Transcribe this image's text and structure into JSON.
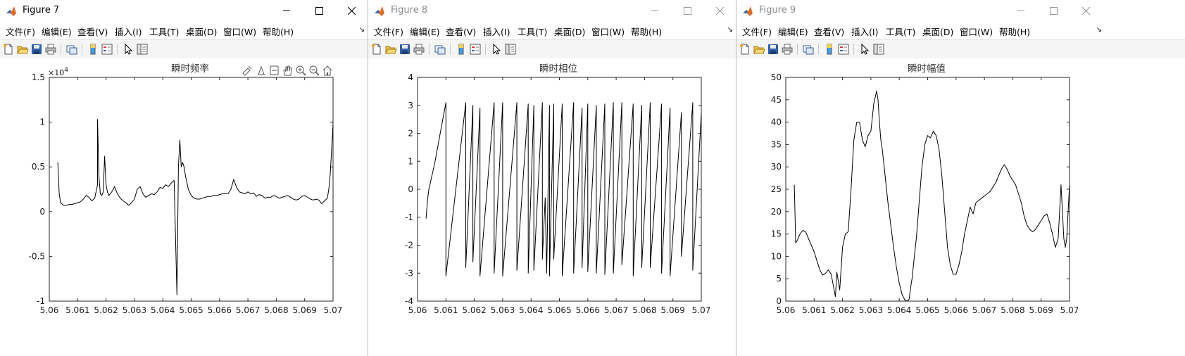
{
  "windows": [
    {
      "title": "Figure 7",
      "active": true,
      "menus": [
        "文件(F)",
        "编辑(E)",
        "查看(V)",
        "插入(I)",
        "工具(T)",
        "桌面(D)",
        "窗口(W)",
        "帮助(H)"
      ],
      "more_glyph": "↘",
      "axes_toolbar": [
        "brush-icon",
        "datatip-icon",
        "rotate-icon",
        "pan-hand-icon",
        "zoom-in-icon",
        "zoom-out-icon",
        "home-icon"
      ]
    },
    {
      "title": "Figure 8",
      "active": false,
      "menus": [
        "文件(F)",
        "编辑(E)",
        "查看(V)",
        "插入(I)",
        "工具(T)",
        "桌面(D)",
        "窗口(W)",
        "帮助(H)"
      ],
      "more_glyph": "↘"
    },
    {
      "title": "Figure 9",
      "active": false,
      "menus": [
        "文件(F)",
        "编辑(E)",
        "查看(V)",
        "插入(I)",
        "工具(T)",
        "桌面(D)",
        "窗口(W)",
        "帮助(H)"
      ],
      "more_glyph": "↘"
    }
  ],
  "toolbar_icons": [
    "new-figure-icon",
    "open-file-icon",
    "save-icon",
    "print-icon",
    "link-plot-icon",
    "insert-colorbar-icon",
    "insert-legend-icon",
    "edit-plot-icon",
    "property-inspector-icon"
  ],
  "colors": {
    "line": "#000000",
    "axis": "#262626",
    "tick_label": "#1a1a1a",
    "window_bg": "#ffffff",
    "toolbar_bg": "#f5f5f5"
  },
  "chart_data": [
    {
      "type": "line",
      "title": "瞬时频率",
      "exponent_label": "×10",
      "exponent_power": "4",
      "xlim": [
        5.06,
        5.07
      ],
      "ylim": [
        -1,
        1.5
      ],
      "xticks": [
        "5.06",
        "5.061",
        "5.062",
        "5.063",
        "5.064",
        "5.065",
        "5.066",
        "5.067",
        "5.068",
        "5.069",
        "5.07"
      ],
      "yticks": [
        "1.5",
        "1",
        "0.5",
        "0",
        "-0.5",
        "-1"
      ],
      "ytick_values": [
        1.5,
        1,
        0.5,
        0,
        -0.5,
        -1
      ],
      "x": [
        5.0603,
        5.06035,
        5.0604,
        5.0605,
        5.0606,
        5.0607,
        5.0608,
        5.0609,
        5.061,
        5.0611,
        5.0612,
        5.0613,
        5.0614,
        5.0615,
        5.0616,
        5.0617,
        5.0617,
        5.06175,
        5.0618,
        5.06185,
        5.0619,
        5.06195,
        5.062,
        5.06205,
        5.0621,
        5.06215,
        5.0622,
        5.0623,
        5.0624,
        5.0625,
        5.0626,
        5.0627,
        5.0628,
        5.0629,
        5.063,
        5.0631,
        5.0632,
        5.0633,
        5.0634,
        5.0635,
        5.0636,
        5.0637,
        5.0638,
        5.0639,
        5.064,
        5.0641,
        5.0642,
        5.0643,
        5.0644,
        5.0645,
        5.06455,
        5.0646,
        5.06465,
        5.0647,
        5.06475,
        5.0648,
        5.0649,
        5.065,
        5.0651,
        5.0652,
        5.0653,
        5.0654,
        5.0655,
        5.0656,
        5.0657,
        5.0658,
        5.0659,
        5.066,
        5.0661,
        5.0662,
        5.0663,
        5.0664,
        5.0665,
        5.0666,
        5.0667,
        5.0668,
        5.0669,
        5.067,
        5.0671,
        5.0672,
        5.0673,
        5.0674,
        5.0675,
        5.0676,
        5.0677,
        5.0678,
        5.0679,
        5.068,
        5.0681,
        5.0682,
        5.0683,
        5.0684,
        5.0685,
        5.0686,
        5.0687,
        5.0688,
        5.0689,
        5.069,
        5.0691,
        5.0692,
        5.0693,
        5.0694,
        5.0695,
        5.0696,
        5.0697,
        5.0698,
        5.06985,
        5.0699,
        5.07
      ],
      "y": [
        0.55,
        0.2,
        0.1,
        0.07,
        0.07,
        0.08,
        0.08,
        0.09,
        0.1,
        0.11,
        0.14,
        0.18,
        0.16,
        0.12,
        0.15,
        0.3,
        1.03,
        0.4,
        0.2,
        0.18,
        0.22,
        0.62,
        0.3,
        0.22,
        0.18,
        0.2,
        0.22,
        0.28,
        0.2,
        0.15,
        0.12,
        0.1,
        0.07,
        0.1,
        0.14,
        0.25,
        0.28,
        0.2,
        0.16,
        0.18,
        0.2,
        0.19,
        0.22,
        0.27,
        0.26,
        0.3,
        0.28,
        0.32,
        0.35,
        -0.93,
        0.5,
        0.8,
        0.5,
        0.55,
        0.5,
        0.4,
        0.25,
        0.18,
        0.15,
        0.14,
        0.14,
        0.15,
        0.16,
        0.17,
        0.17,
        0.18,
        0.18,
        0.19,
        0.2,
        0.2,
        0.2,
        0.25,
        0.36,
        0.27,
        0.22,
        0.21,
        0.2,
        0.22,
        0.2,
        0.21,
        0.17,
        0.19,
        0.18,
        0.15,
        0.16,
        0.16,
        0.18,
        0.17,
        0.15,
        0.16,
        0.17,
        0.18,
        0.16,
        0.14,
        0.13,
        0.14,
        0.17,
        0.18,
        0.16,
        0.14,
        0.13,
        0.14,
        0.13,
        0.09,
        0.12,
        0.15,
        0.25,
        0.42,
        0.97
      ],
      "grid": false
    },
    {
      "type": "line",
      "title": "瞬时相位",
      "xlim": [
        5.06,
        5.07
      ],
      "ylim": [
        -4,
        4
      ],
      "xticks": [
        "5.06",
        "5.061",
        "5.062",
        "5.063",
        "5.064",
        "5.065",
        "5.066",
        "5.067",
        "5.068",
        "5.069",
        "5.07"
      ],
      "yticks": [
        "4",
        "3",
        "2",
        "1",
        "0",
        "-1",
        "-2",
        "-3",
        "-4"
      ],
      "ytick_values": [
        4,
        3,
        2,
        1,
        0,
        -1,
        -2,
        -3,
        -4
      ],
      "x": [
        5.0603,
        5.06035,
        5.0604,
        5.0606,
        5.0608,
        5.061,
        5.061,
        5.0617,
        5.0617,
        5.06195,
        5.06195,
        5.0622,
        5.0622,
        5.0627,
        5.0627,
        5.063,
        5.063,
        5.0635,
        5.0635,
        5.0639,
        5.0639,
        5.0641,
        5.0641,
        5.0644,
        5.0644,
        5.0645,
        5.06455,
        5.06465,
        5.06465,
        5.0648,
        5.0648,
        5.0651,
        5.0651,
        5.0655,
        5.0655,
        5.0658,
        5.0658,
        5.066,
        5.066,
        5.0663,
        5.0663,
        5.0666,
        5.0666,
        5.0669,
        5.0669,
        5.0672,
        5.0672,
        5.0676,
        5.0676,
        5.0679,
        5.0679,
        5.0682,
        5.0682,
        5.0686,
        5.0686,
        5.0689,
        5.0689,
        5.0693,
        5.0693,
        5.0697,
        5.0697,
        5.07
      ],
      "y": [
        -1.05,
        -0.4,
        0,
        0.9,
        2.0,
        3.1,
        -3.1,
        3.1,
        -2.8,
        3.0,
        -2.6,
        2.9,
        -3.1,
        3.1,
        -3.0,
        3.1,
        -3.1,
        3.1,
        -2.9,
        3.05,
        -3.0,
        3.0,
        -2.9,
        3.1,
        -2.5,
        -0.3,
        -3.0,
        3.0,
        -3.1,
        3.05,
        -2.5,
        3.05,
        -3.1,
        3.1,
        -3.0,
        2.9,
        -2.8,
        3.05,
        -2.95,
        3.0,
        -3.0,
        3.05,
        -3.05,
        3.1,
        -3.0,
        3.1,
        -2.7,
        3.05,
        -3.1,
        3.0,
        -2.8,
        3.1,
        -2.8,
        3.05,
        -3.0,
        2.9,
        -3.1,
        2.75,
        -2.4,
        3.1,
        -2.9,
        2.7
      ],
      "grid": false
    },
    {
      "type": "line",
      "title": "瞬时幅值",
      "xlim": [
        5.06,
        5.07
      ],
      "ylim": [
        0,
        50
      ],
      "xticks": [
        "5.06",
        "5.061",
        "5.062",
        "5.063",
        "5.064",
        "5.065",
        "5.066",
        "5.067",
        "5.068",
        "5.069",
        "5.07"
      ],
      "yticks": [
        "50",
        "45",
        "40",
        "35",
        "30",
        "25",
        "20",
        "15",
        "10",
        "5",
        "0"
      ],
      "ytick_values": [
        50,
        45,
        40,
        35,
        30,
        25,
        20,
        15,
        10,
        5,
        0
      ],
      "x": [
        5.0603,
        5.06035,
        5.0604,
        5.0605,
        5.0606,
        5.0607,
        5.0608,
        5.0609,
        5.061,
        5.0611,
        5.0612,
        5.0613,
        5.0614,
        5.0615,
        5.0616,
        5.06175,
        5.0618,
        5.0619,
        5.062,
        5.0621,
        5.0622,
        5.0623,
        5.0624,
        5.0625,
        5.0626,
        5.0627,
        5.0628,
        5.0629,
        5.063,
        5.0631,
        5.0632,
        5.06325,
        5.0633,
        5.06335,
        5.0634,
        5.0635,
        5.0636,
        5.0637,
        5.0638,
        5.0639,
        5.064,
        5.0641,
        5.0642,
        5.0643,
        5.06435,
        5.0644,
        5.06445,
        5.0645,
        5.0646,
        5.0647,
        5.0648,
        5.0649,
        5.065,
        5.0651,
        5.0652,
        5.0653,
        5.0654,
        5.0655,
        5.0656,
        5.0657,
        5.0658,
        5.0659,
        5.066,
        5.0661,
        5.0662,
        5.0663,
        5.0664,
        5.0665,
        5.0666,
        5.0667,
        5.0668,
        5.0669,
        5.067,
        5.0671,
        5.0672,
        5.0673,
        5.0674,
        5.0675,
        5.0676,
        5.0677,
        5.0678,
        5.0679,
        5.068,
        5.0681,
        5.0682,
        5.0683,
        5.0684,
        5.0685,
        5.0686,
        5.0687,
        5.0688,
        5.0689,
        5.069,
        5.0691,
        5.0692,
        5.0693,
        5.0694,
        5.0695,
        5.0696,
        5.0697,
        5.0698,
        5.06985,
        5.0699,
        5.06995,
        5.07
      ],
      "y": [
        26,
        13,
        13.5,
        15,
        15.8,
        15.5,
        14,
        12.5,
        11,
        9,
        7,
        5.8,
        6.2,
        7,
        6,
        1,
        6.5,
        2.5,
        12,
        15,
        15.5,
        25,
        36,
        40,
        40,
        36,
        34.5,
        37,
        38,
        44,
        47,
        45,
        40,
        36,
        34,
        28,
        22,
        17,
        12,
        7.5,
        4,
        1.5,
        0.2,
        0,
        0.5,
        3,
        5,
        8,
        14,
        22,
        30,
        35,
        37,
        36.5,
        38,
        37,
        34,
        28,
        20,
        12,
        8,
        6,
        6,
        8,
        11,
        15,
        18,
        21,
        19.5,
        22,
        22.5,
        23,
        23.5,
        24,
        24.5,
        25.5,
        26.5,
        28,
        29.5,
        30.5,
        29.5,
        28,
        27,
        26,
        24,
        22,
        19,
        17,
        16,
        15.5,
        16,
        17,
        18,
        19,
        19.5,
        17.5,
        15,
        12,
        14,
        26,
        14,
        12,
        14,
        20,
        26
      ],
      "grid": false
    }
  ]
}
